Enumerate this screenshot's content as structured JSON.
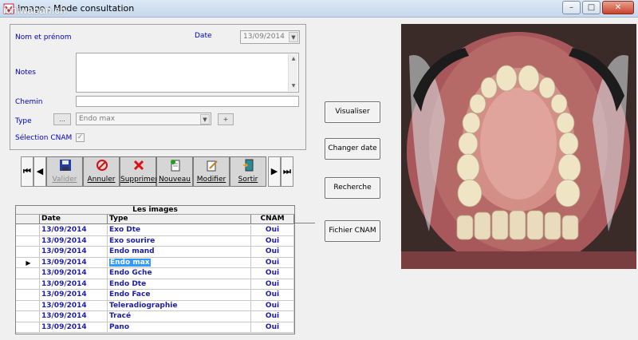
{
  "window": {
    "title": "Image : Mode consultation",
    "watermark": "ichiwaban.ch"
  },
  "form": {
    "name_label": "Nom et prénom",
    "date_label": "Date",
    "date_value": "13/09/2014",
    "notes_label": "Notes",
    "chemin_label": "Chemin",
    "type_label": "Type",
    "type_button": "...",
    "type_value": "Endo max",
    "type_add": "+",
    "cnam_label": "Sélection CNAM",
    "cnam_check": "✓"
  },
  "toolbar": {
    "first": "⏮",
    "prev": "◀",
    "next": "▶",
    "last": "⏭",
    "valider": "Valider",
    "annuler": "Annuler",
    "supprimer": "Supprimer",
    "nouveau": "Nouveau",
    "modifier": "Modifier",
    "sortir": "Sortir"
  },
  "side_buttons": {
    "visualiser": "Visualiser",
    "changer_date": "Changer date",
    "recherche": "Recherche",
    "fichier_cnam": "Fichier CNAM"
  },
  "grid": {
    "title": "Les images",
    "columns": [
      "Date",
      "Type",
      "CNAM"
    ],
    "current_marker": "▶",
    "rows": [
      {
        "date": "13/09/2014",
        "type": "Exo Dte",
        "cnam": "Oui"
      },
      {
        "date": "13/09/2014",
        "type": "Exo sourire",
        "cnam": "Oui"
      },
      {
        "date": "13/09/2014",
        "type": "Endo mand",
        "cnam": "Oui"
      },
      {
        "date": "13/09/2014",
        "type": "Endo max",
        "cnam": "Oui",
        "current": true
      },
      {
        "date": "13/09/2014",
        "type": "Endo Gche",
        "cnam": "Oui"
      },
      {
        "date": "13/09/2014",
        "type": "Endo Dte",
        "cnam": "Oui"
      },
      {
        "date": "13/09/2014",
        "type": "Endo Face",
        "cnam": "Oui"
      },
      {
        "date": "13/09/2014",
        "type": "Teleradiographie",
        "cnam": "Oui"
      },
      {
        "date": "13/09/2014",
        "type": "Tracé",
        "cnam": "Oui"
      },
      {
        "date": "13/09/2014",
        "type": "Pano",
        "cnam": "Oui"
      }
    ]
  },
  "colors": {
    "label_blue": "#0000c8",
    "grid_text": "#1d1da8",
    "selection": "#3399ff"
  }
}
